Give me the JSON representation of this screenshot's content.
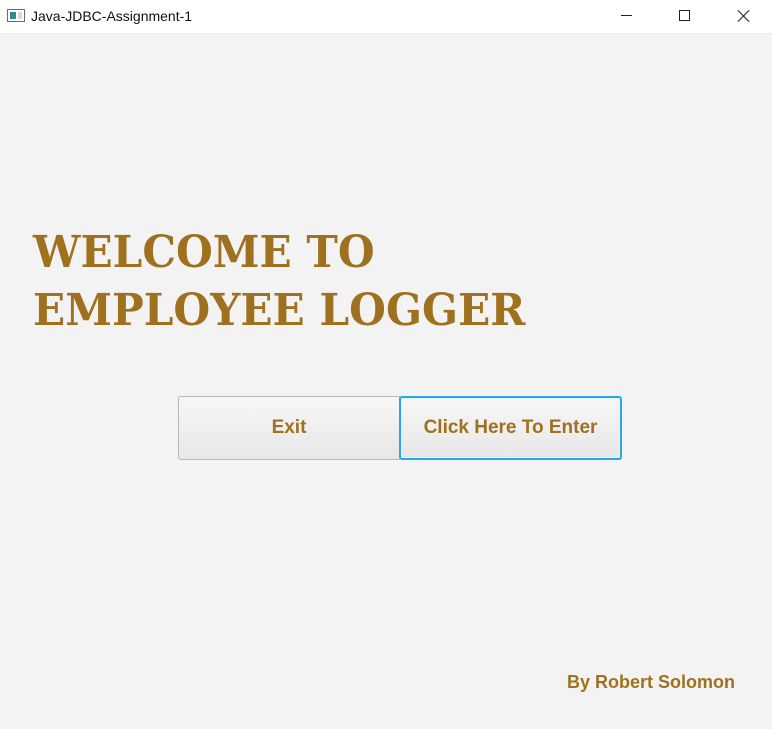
{
  "window": {
    "title": "Java-JDBC-Assignment-1"
  },
  "welcome": {
    "line1": "WELCOME TO",
    "line2": "EMPLOYEE LOGGER"
  },
  "buttons": {
    "exit_label": "Exit",
    "enter_label": "Click Here To Enter"
  },
  "footer": {
    "author": "By Robert Solomon"
  },
  "colors": {
    "accent": "#9f711f",
    "focus": "#2aa7e6",
    "background": "#f3f3f3"
  },
  "icons": {
    "app": "app-window-icon",
    "minimize": "minimize-icon",
    "maximize": "maximize-icon",
    "close": "close-icon"
  }
}
